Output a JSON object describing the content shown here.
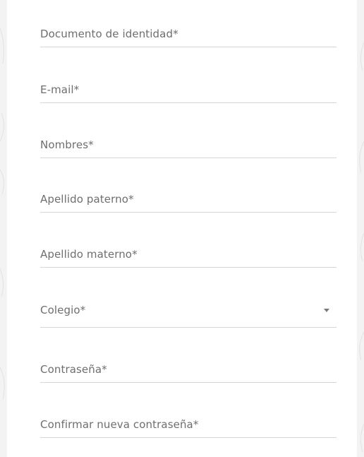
{
  "form": {
    "fields": [
      {
        "label": "Documento de identidad*",
        "type": "text"
      },
      {
        "label": "E-mail*",
        "type": "email"
      },
      {
        "label": "Nombres*",
        "type": "text"
      },
      {
        "label": "Apellido paterno*",
        "type": "text"
      },
      {
        "label": "Apellido materno*",
        "type": "text"
      },
      {
        "label": "Colegio*",
        "type": "select",
        "icon": "dropdown-caret-icon"
      },
      {
        "label": "Contraseña*",
        "type": "password"
      },
      {
        "label": "Confirmar nueva contraseña*",
        "type": "password"
      }
    ]
  }
}
